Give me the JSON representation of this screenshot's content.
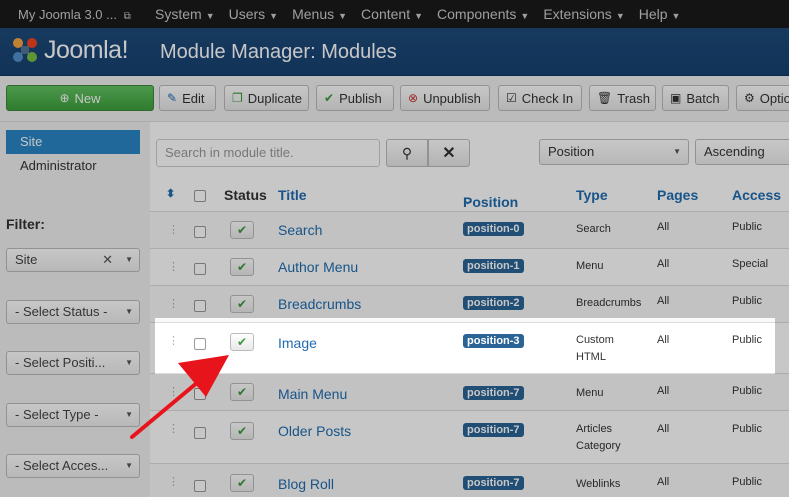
{
  "navbar": {
    "site_name": "My Joomla 3.0 ...",
    "external_icon": "external-link-icon",
    "menu": [
      "System",
      "Users",
      "Menus",
      "Content",
      "Components",
      "Extensions",
      "Help"
    ]
  },
  "header": {
    "logo_text": "Joomla!",
    "title": "Module Manager: Modules"
  },
  "toolbar": {
    "new": "New",
    "edit": "Edit",
    "duplicate": "Duplicate",
    "publish": "Publish",
    "unpublish": "Unpublish",
    "checkin": "Check In",
    "trash": "Trash",
    "batch": "Batch",
    "options": "Options"
  },
  "sidebar": {
    "items": [
      {
        "label": "Site",
        "active": true
      },
      {
        "label": "Administrator",
        "active": false
      }
    ],
    "filter_label": "Filter:",
    "filters": [
      "Site",
      "- Select Status -",
      "- Select Positi...",
      "- Select Type -",
      "- Select Acces..."
    ]
  },
  "search": {
    "placeholder": "Search in module title."
  },
  "sort": {
    "field": "Position",
    "direction": "Ascending"
  },
  "table": {
    "headers": {
      "status": "Status",
      "title": "Title",
      "position": "Position",
      "type": "Type",
      "pages": "Pages",
      "access": "Access"
    },
    "rows": [
      {
        "title": "Search",
        "position": "position-0",
        "type": "Search",
        "pages": "All",
        "access": "Public"
      },
      {
        "title": "Author Menu",
        "position": "position-1",
        "type": "Menu",
        "pages": "All",
        "access": "Special"
      },
      {
        "title": "Breadcrumbs",
        "position": "position-2",
        "type": "Breadcrumbs",
        "pages": "All",
        "access": "Public"
      },
      {
        "title": "Image",
        "position": "position-3",
        "type": "Custom HTML",
        "type_line1": "Custom",
        "type_line2": "HTML",
        "pages": "All",
        "access": "Public"
      },
      {
        "title": "Main Menu",
        "position": "position-7",
        "type": "Menu",
        "pages": "All",
        "access": "Public"
      },
      {
        "title": "Older Posts",
        "position": "position-7",
        "type": "Articles Category",
        "type_line1": "Articles",
        "type_line2": "Category",
        "pages": "All",
        "access": "Public"
      },
      {
        "title": "Blog Roll",
        "position": "position-7",
        "type": "Weblinks",
        "pages": "All",
        "access": "Public"
      }
    ]
  },
  "colors": {
    "header_blue": "#1e4a7a",
    "link_blue": "#1f6cb0",
    "badge_blue": "#2a6496",
    "new_green": "#4cae4c",
    "annotation_red": "#e8141b"
  }
}
